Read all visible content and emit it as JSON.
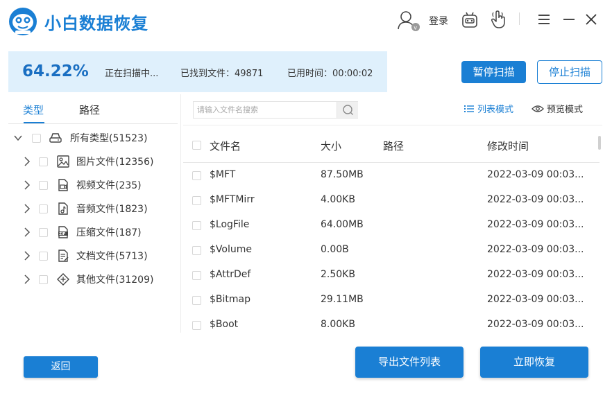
{
  "header": {
    "title": "小白数据恢复",
    "login_label": "登录",
    "icons": [
      "logo-icon",
      "user-icon",
      "robot-icon",
      "hand-icon",
      "menu-icon",
      "minimize-icon",
      "close-icon"
    ]
  },
  "status": {
    "percent": "64.22%",
    "progress": 0.6422,
    "scanning": "正在扫描中...",
    "found": "已找到文件：49871",
    "elapsed": "已用时间：00:00:02",
    "pause_label": "暂停扫描",
    "stop_label": "停止扫描"
  },
  "sidebar": {
    "tabs": [
      {
        "label": "类型",
        "active": true
      },
      {
        "label": "路径",
        "active": false
      }
    ],
    "root": {
      "label": "所有类型(51523)",
      "icon": "drive-icon"
    },
    "items": [
      {
        "label": "图片文件(12356)",
        "icon": "image-file-icon"
      },
      {
        "label": "视频文件(235)",
        "icon": "video-file-icon"
      },
      {
        "label": "音频文件(1823)",
        "icon": "audio-file-icon"
      },
      {
        "label": "压缩文件(187)",
        "icon": "zip-file-icon"
      },
      {
        "label": "文档文件(5713)",
        "icon": "document-file-icon"
      },
      {
        "label": "其他文件(31209)",
        "icon": "other-file-icon"
      }
    ]
  },
  "search": {
    "placeholder": "请输入文件名搜索",
    "value": ""
  },
  "view_modes": [
    {
      "label": "列表模式",
      "active": true,
      "icon": "list-icon"
    },
    {
      "label": "预览模式",
      "active": false,
      "icon": "eye-icon"
    }
  ],
  "table": {
    "columns": [
      "文件名",
      "大小",
      "路径",
      "修改时间"
    ],
    "rows": [
      {
        "name": "$MFT",
        "size": "87.50MB",
        "path": "",
        "modified": "2022-03-09 00:03..."
      },
      {
        "name": "$MFTMirr",
        "size": "4.00KB",
        "path": "",
        "modified": "2022-03-09 00:03..."
      },
      {
        "name": "$LogFile",
        "size": "64.00MB",
        "path": "",
        "modified": "2022-03-09 00:03..."
      },
      {
        "name": "$Volume",
        "size": "0.00B",
        "path": "",
        "modified": "2022-03-09 00:03..."
      },
      {
        "name": "$AttrDef",
        "size": "2.50KB",
        "path": "",
        "modified": "2022-03-09 00:03..."
      },
      {
        "name": "$Bitmap",
        "size": "29.11MB",
        "path": "",
        "modified": "2022-03-09 00:03..."
      },
      {
        "name": "$Boot",
        "size": "8.00KB",
        "path": "",
        "modified": "2022-03-09 00:03..."
      }
    ]
  },
  "footer": {
    "back_label": "返回",
    "export_label": "导出文件列表",
    "recover_label": "立即恢复"
  },
  "colors": {
    "accent": "#1a7fd4",
    "status_bg": "#dff0fc"
  }
}
